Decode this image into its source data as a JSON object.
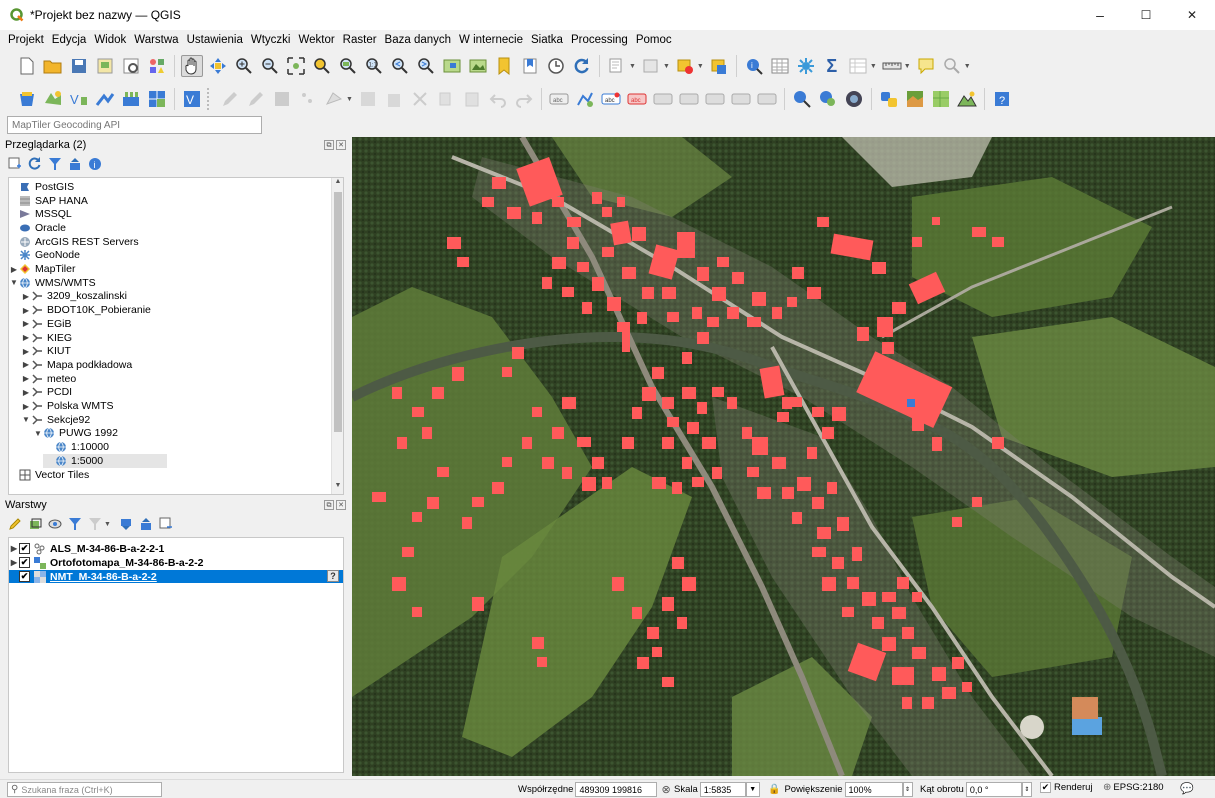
{
  "window": {
    "title": "*Projekt bez nazwy — QGIS",
    "minimize": "–",
    "maximize": "☐",
    "close": "✕"
  },
  "menu": [
    "Projekt",
    "Edycja",
    "Widok",
    "Warstwa",
    "Ustawienia",
    "Wtyczki",
    "Wektor",
    "Raster",
    "Baza danych",
    "W internecie",
    "Siatka",
    "Processing",
    "Pomoc"
  ],
  "locator": {
    "placeholder": "MapTiler Geocoding API"
  },
  "browser": {
    "title": "Przeglądarka (2)",
    "items": [
      {
        "label": "PostGIS",
        "icon": "postgis-icon",
        "indent": 0,
        "arrow": ""
      },
      {
        "label": "SAP HANA",
        "icon": "saphana-icon",
        "indent": 0,
        "arrow": ""
      },
      {
        "label": "MSSQL",
        "icon": "mssql-icon",
        "indent": 0,
        "arrow": ""
      },
      {
        "label": "Oracle",
        "icon": "oracle-icon",
        "indent": 0,
        "arrow": ""
      },
      {
        "label": "ArcGIS REST Servers",
        "icon": "arcgis-icon",
        "indent": 0,
        "arrow": ""
      },
      {
        "label": "GeoNode",
        "icon": "geonode-icon",
        "indent": 0,
        "arrow": ""
      },
      {
        "label": "MapTiler",
        "icon": "maptiler-icon",
        "indent": 0,
        "arrow": "▶"
      },
      {
        "label": "WMS/WMTS",
        "icon": "wms-globe-icon",
        "indent": 0,
        "arrow": "▼"
      },
      {
        "label": "3209_koszalinski",
        "icon": "wms-connection-icon",
        "indent": 1,
        "arrow": "▶"
      },
      {
        "label": "BDOT10K_Pobieranie",
        "icon": "wms-connection-icon",
        "indent": 1,
        "arrow": "▶"
      },
      {
        "label": "EGiB",
        "icon": "wms-connection-icon",
        "indent": 1,
        "arrow": "▶"
      },
      {
        "label": "KIEG",
        "icon": "wms-connection-icon",
        "indent": 1,
        "arrow": "▶"
      },
      {
        "label": "KIUT",
        "icon": "wms-connection-icon",
        "indent": 1,
        "arrow": "▶"
      },
      {
        "label": "Mapa podkładowa",
        "icon": "wms-connection-icon",
        "indent": 1,
        "arrow": "▶"
      },
      {
        "label": "meteo",
        "icon": "wms-connection-icon",
        "indent": 1,
        "arrow": "▶"
      },
      {
        "label": "PCDI",
        "icon": "wms-connection-icon",
        "indent": 1,
        "arrow": "▶"
      },
      {
        "label": "Polska WMTS",
        "icon": "wms-connection-icon",
        "indent": 1,
        "arrow": "▶"
      },
      {
        "label": "Sekcje92",
        "icon": "wms-connection-icon",
        "indent": 1,
        "arrow": "▼"
      },
      {
        "label": "PUWG 1992",
        "icon": "wms-globe-icon",
        "indent": 2,
        "arrow": "▼"
      },
      {
        "label": "1:10000",
        "icon": "wms-globe-icon",
        "indent": 3,
        "arrow": ""
      },
      {
        "label": "1:5000",
        "icon": "wms-globe-icon",
        "indent": 3,
        "arrow": "",
        "selected": true
      },
      {
        "label": "Vector Tiles",
        "icon": "vector-tiles-icon",
        "indent": 0,
        "arrow": ""
      }
    ]
  },
  "layers": {
    "title": "Warstwy",
    "items": [
      {
        "label": "ALS_M-34-86-B-a-2-2-1",
        "icon": "pointcloud-icon",
        "checked": true,
        "selected": false
      },
      {
        "label": "Ortofotomapa_M-34-86-B-a-2-2",
        "icon": "raster-icon",
        "checked": true,
        "selected": false
      },
      {
        "label": "NMT_M-34-86-B-a-2-2",
        "icon": "raster-dem-icon",
        "checked": true,
        "selected": true
      }
    ]
  },
  "statusbar": {
    "search_placeholder": "Szukana fraza (Ctrl+K)",
    "coord_label": "Współrzędne",
    "coord_value": "489309 199816",
    "scale_label": "Skala",
    "scale_value": "1:5835",
    "magnifier_label": "Powiększenie",
    "magnifier_value": "100%",
    "rotation_label": "Kąt obrotu",
    "rotation_value": "0,0 °",
    "render_label": "Renderuj",
    "crs": "EPSG:2180"
  },
  "colors": {
    "building_fill": "#ff5a5a",
    "selection": "#0078d7",
    "terrain_dark": "#3c4e2c",
    "river": "#5b6650"
  }
}
